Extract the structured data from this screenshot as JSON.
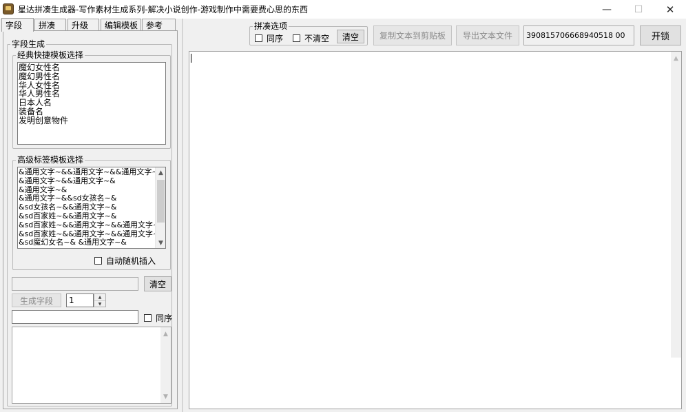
{
  "window": {
    "title": "星达拼凑生成器-写作素材生成系列-解决小说创作-游戏制作中需要费心思的东西",
    "minimize": "—",
    "maximize": "☐",
    "close": "✕"
  },
  "tabs": [
    {
      "label": "字段"
    },
    {
      "label": "拼凑"
    },
    {
      "label": "升级"
    },
    {
      "label": "编辑模板"
    },
    {
      "label": "参考"
    }
  ],
  "field_group": {
    "title": "字段生成",
    "classic": {
      "title": "经典快捷模板选择",
      "items": [
        "魔幻女性名",
        "魔幻男性名",
        "华人女性名",
        "华人男性名",
        "日本人名",
        "装备名",
        "发明创意物件"
      ]
    },
    "advanced": {
      "title": "高级标签模板选择",
      "items": [
        "&通用文字~&&通用文字~&&通用文字~&",
        "&通用文字~&&通用文字~&",
        "&通用文字~&",
        "&通用文字~&&sd女孩名~&",
        "&sd女孩名~&&通用文字~&",
        "&sd百家姓~&&通用文字~&",
        "&sd百家姓~&&通用文字~&&通用文字~&",
        "&sd百家姓~&&通用文字~&&通用文字~&",
        "&sd魔幻女名~& &通用文字~&"
      ],
      "auto_random_label": "自动随机插入"
    }
  },
  "controls": {
    "clear_label": "清空",
    "generate_label": "生成字段",
    "count_value": "1",
    "same_order_label": "同序"
  },
  "options": {
    "title": "拼凑选项",
    "same_order_label": "同序",
    "no_clear_label": "不清空",
    "clear_label": "清空"
  },
  "toolbar": {
    "copy_label": "复制文本到剪贴板",
    "export_label": "导出文本文件",
    "code_value": "390815706668940518 00",
    "unlock_label": "开锁"
  }
}
